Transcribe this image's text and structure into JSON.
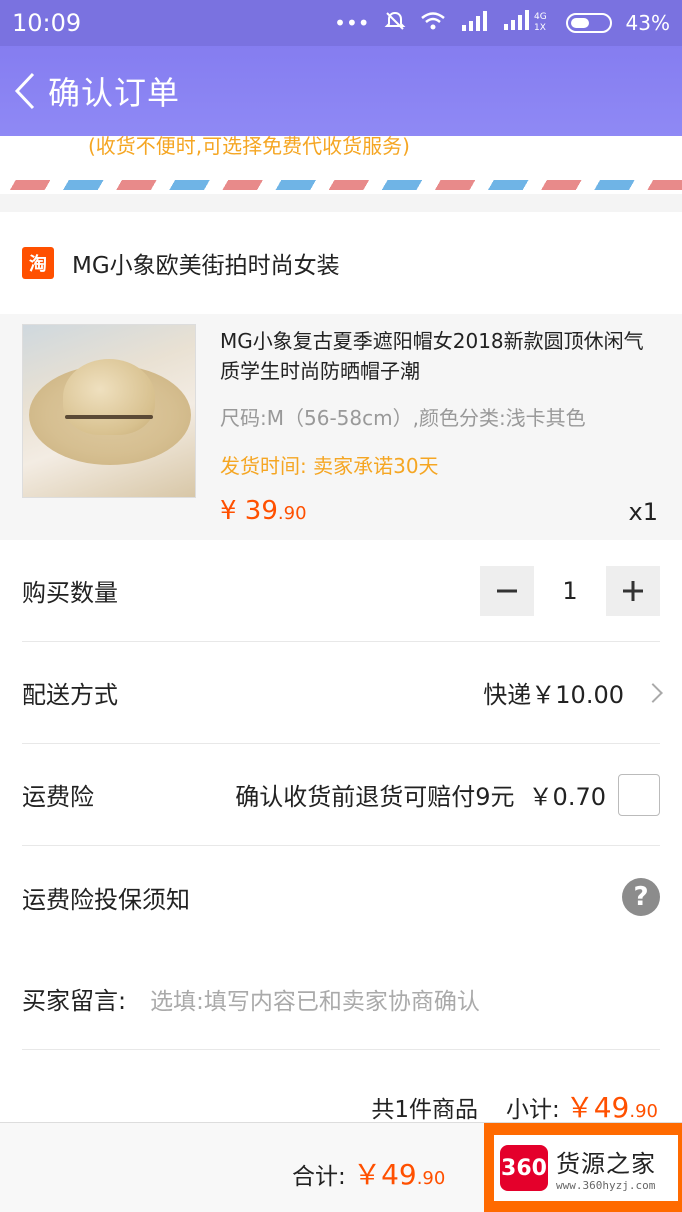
{
  "status_bar": {
    "time": "10:09",
    "icons": [
      "more-icon",
      "mute-icon",
      "wifi-icon",
      "signal-icon",
      "signal-4g-icon",
      "battery-icon"
    ],
    "battery_pct": "43%"
  },
  "nav": {
    "title": "确认订单"
  },
  "address_hint": "(收货不便时,可选择免费代收货服务)",
  "shop": {
    "logo_text": "淘",
    "name": "MG小象欧美街拍时尚女装"
  },
  "item": {
    "title": "MG小象复古夏季遮阳帽女2018新款圆顶休闲气质学生时尚防晒帽子潮",
    "spec": "尺码:M（56-58cm）,颜色分类:浅卡其色",
    "shipping": "发货时间: 卖家承诺30天",
    "price_major": "¥ 39",
    "price_minor": ".90",
    "qty_label": "x1"
  },
  "quantity": {
    "label": "购买数量",
    "minus": "−",
    "value": "1",
    "plus": "+"
  },
  "delivery": {
    "label": "配送方式",
    "value": "快递￥10.00"
  },
  "insurance": {
    "label": "运费险",
    "desc": "确认收货前退货可赔付9元",
    "price": "￥0.70"
  },
  "insurance_notice": {
    "label": "运费险投保须知",
    "help": "?"
  },
  "buyer_note": {
    "label": "买家留言:",
    "placeholder": "选填:填写内容已和卖家协商确认"
  },
  "summary": {
    "count_text": "共1件商品",
    "subtotal_label": "小计:",
    "subtotal_major": "￥49",
    "subtotal_minor": ".90"
  },
  "footer": {
    "total_label": "合计:",
    "total_major": "￥49",
    "total_minor": ".90",
    "watermark_logo": "360",
    "watermark_name": "货源之家",
    "watermark_url": "www.360hyzj.com"
  },
  "colors": {
    "nav": "#857df0",
    "accent": "#ff5000",
    "ship_text": "#f5a623",
    "submit": "#ff6a00"
  }
}
